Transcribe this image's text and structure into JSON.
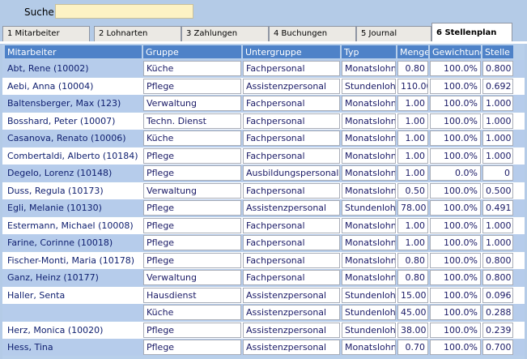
{
  "search": {
    "label": "Suche:",
    "value": ""
  },
  "tabs": [
    {
      "label": "1 Mitarbeiter"
    },
    {
      "label": "2 Lohnarten"
    },
    {
      "label": "3 Zahlungen"
    },
    {
      "label": "4 Buchungen"
    },
    {
      "label": "5 Journal"
    },
    {
      "label": "6 Stellenplan"
    }
  ],
  "active_tab": "6 Stellenplan",
  "columns": {
    "mitarbeiter": "Mitarbeiter",
    "gruppe": "Gruppe",
    "untergruppe": "Untergruppe",
    "typ": "Typ",
    "menge": "Menge",
    "gewichtung": "Gewichtung",
    "stelle": "Stelle"
  },
  "rows": [
    {
      "name": "Abt, Rene (10002)",
      "gruppe": "Küche",
      "untergruppe": "Fachpersonal",
      "typ": "Monatslohn",
      "menge": "0.80",
      "gewichtung": "100.0%",
      "stelle": "0.800"
    },
    {
      "name": "Aebi, Anna (10004)",
      "gruppe": "Pflege",
      "untergruppe": "Assistenzpersonal",
      "typ": "Stundenlohn",
      "menge": "110.00",
      "gewichtung": "100.0%",
      "stelle": "0.692"
    },
    {
      "name": "Baltensberger, Max (123)",
      "gruppe": "Verwaltung",
      "untergruppe": "Fachpersonal",
      "typ": "Monatslohn",
      "menge": "1.00",
      "gewichtung": "100.0%",
      "stelle": "1.000"
    },
    {
      "name": "Bosshard, Peter (10007)",
      "gruppe": "Techn. Dienst",
      "untergruppe": "Fachpersonal",
      "typ": "Monatslohn",
      "menge": "1.00",
      "gewichtung": "100.0%",
      "stelle": "1.000"
    },
    {
      "name": "Casanova, Renato (10006)",
      "gruppe": "Küche",
      "untergruppe": "Fachpersonal",
      "typ": "Monatslohn",
      "menge": "1.00",
      "gewichtung": "100.0%",
      "stelle": "1.000"
    },
    {
      "name": "Combertaldi, Alberto (10184)",
      "gruppe": "Pflege",
      "untergruppe": "Fachpersonal",
      "typ": "Monatslohn",
      "menge": "1.00",
      "gewichtung": "100.0%",
      "stelle": "1.000"
    },
    {
      "name": "Degelo, Lorenz (10148)",
      "gruppe": "Pflege",
      "untergruppe": "Ausbildungspersonal",
      "typ": "Monatslohn",
      "menge": "1.00",
      "gewichtung": "0.0%",
      "stelle": "0"
    },
    {
      "name": "Duss, Regula (10173)",
      "gruppe": "Verwaltung",
      "untergruppe": "Fachpersonal",
      "typ": "Monatslohn",
      "menge": "0.50",
      "gewichtung": "100.0%",
      "stelle": "0.500"
    },
    {
      "name": "Egli, Melanie (10130)",
      "gruppe": "Pflege",
      "untergruppe": "Assistenzpersonal",
      "typ": "Stundenlohn",
      "menge": "78.00",
      "gewichtung": "100.0%",
      "stelle": "0.491"
    },
    {
      "name": "Estermann, Michael (10008)",
      "gruppe": "Pflege",
      "untergruppe": "Fachpersonal",
      "typ": "Monatslohn",
      "menge": "1.00",
      "gewichtung": "100.0%",
      "stelle": "1.000"
    },
    {
      "name": "Farine, Corinne (10018)",
      "gruppe": "Pflege",
      "untergruppe": "Fachpersonal",
      "typ": "Monatslohn",
      "menge": "1.00",
      "gewichtung": "100.0%",
      "stelle": "1.000"
    },
    {
      "name": "Fischer-Monti, Maria (10178)",
      "gruppe": "Pflege",
      "untergruppe": "Fachpersonal",
      "typ": "Monatslohn",
      "menge": "0.80",
      "gewichtung": "100.0%",
      "stelle": "0.800"
    },
    {
      "name": "Ganz, Heinz (10177)",
      "gruppe": "Verwaltung",
      "untergruppe": "Fachpersonal",
      "typ": "Monatslohn",
      "menge": "0.80",
      "gewichtung": "100.0%",
      "stelle": "0.800"
    },
    {
      "name": "Haller, Senta",
      "gruppe": "Hausdienst",
      "untergruppe": "Assistenzpersonal",
      "typ": "Stundenlohn",
      "menge": "15.00",
      "gewichtung": "100.0%",
      "stelle": "0.096"
    },
    {
      "name": "",
      "gruppe": "Küche",
      "untergruppe": "Assistenzpersonal",
      "typ": "Stundenlohn",
      "menge": "45.00",
      "gewichtung": "100.0%",
      "stelle": "0.288"
    },
    {
      "name": "Herz, Monica (10020)",
      "gruppe": "Pflege",
      "untergruppe": "Assistenzpersonal",
      "typ": "Stundenlohn",
      "menge": "38.00",
      "gewichtung": "100.0%",
      "stelle": "0.239"
    },
    {
      "name": "Hess, Tina",
      "gruppe": "Pflege",
      "untergruppe": "Assistenzpersonal",
      "typ": "Monatslohn",
      "menge": "0.70",
      "gewichtung": "100.0%",
      "stelle": "0.700"
    }
  ]
}
